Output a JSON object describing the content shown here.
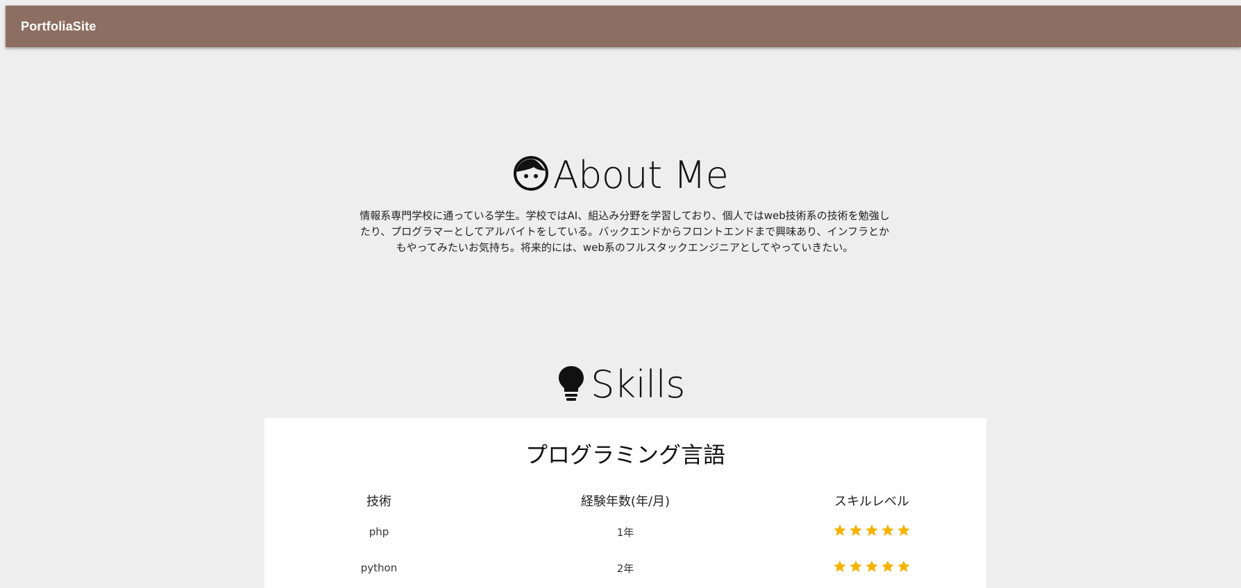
{
  "header": {
    "brand": "PortfoliaSite",
    "bg_color": "#8d6e63"
  },
  "about": {
    "icon": "face-icon",
    "title": "About Me",
    "text": "情報系専門学校に通っている学生。学校ではAI、組込み分野を学習しており、個人ではweb技術系の技術を勉強したり、プログラマーとしてアルバイトをしている。バックエンドからフロントエンドまで興味あり、インフラとかもやってみたいお気持ち。将来的には、web系のフルスタックエンジニアとしてやっていきたい。"
  },
  "skills": {
    "icon": "lightbulb-icon",
    "title": "Skills",
    "card_title": "プログラミング言語",
    "columns": [
      "技術",
      "経験年数(年/月)",
      "スキルレベル"
    ],
    "rows": [
      {
        "tech": "php",
        "years": "1年",
        "level": 5
      },
      {
        "tech": "python",
        "years": "2年",
        "level": 5
      }
    ],
    "star_color": "#f5b301"
  }
}
